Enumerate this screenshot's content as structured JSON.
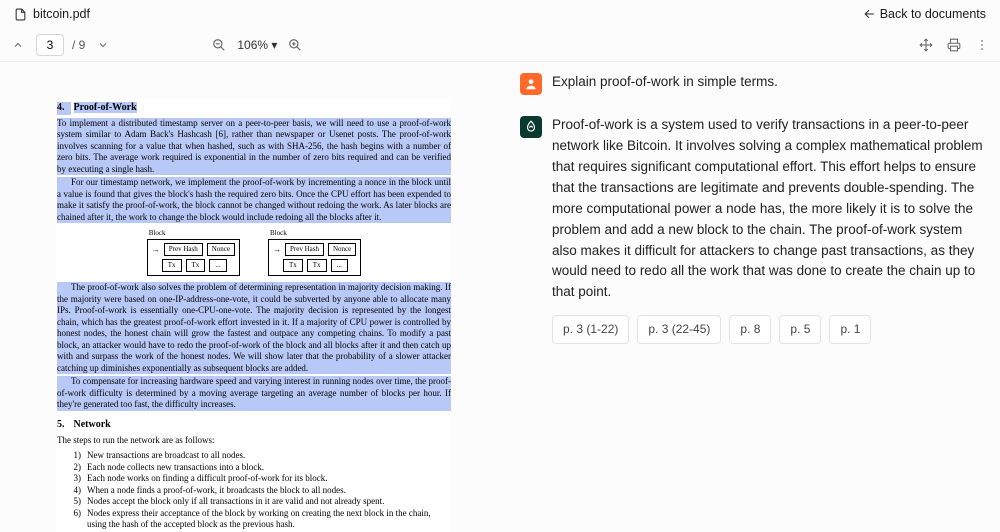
{
  "header": {
    "filename": "bitcoin.pdf",
    "back_label": "Back to documents"
  },
  "toolbar": {
    "page_current": "3",
    "page_total": "/ 9",
    "zoom_label": "106%"
  },
  "doc": {
    "sec4_num": "4.",
    "sec4_title": "Proof-of-Work",
    "p1a": "To implement a distributed timestamp server on a peer-to-peer basis, we will need to use a proof-of-work system similar to Adam Back's Hashcash [6], rather than newspaper or Usenet posts. The proof-of-work involves scanning for a value that when hashed, such as with SHA-256, the hash begins with a number of zero bits.  The average work required is exponential in the number of zero bits required and can be verified by executing a single hash.",
    "p1b": "For our timestamp network, we implement the proof-of-work by incrementing a nonce in the block until a value is found that gives the block's hash the required zero bits.  Once the CPU effort has been expended to make it satisfy the proof-of-work, the block cannot be changed without redoing the work.  As later blocks are chained after it, the work to change the block would include redoing all the blocks after it.",
    "diag": {
      "block_label": "Block",
      "prev": "Prev Hash",
      "nonce": "Nonce",
      "tx": "Tx",
      "dots": "..."
    },
    "p2a": "The proof-of-work also solves the problem of determining representation in majority decision making.  If the majority were based on one-IP-address-one-vote, it could be subverted by anyone able to allocate many IPs.  Proof-of-work is essentially one-CPU-one-vote.  The majority decision is represented by the longest chain, which has the greatest proof-of-work effort invested in it.  If a majority of CPU power is controlled by honest nodes, the honest chain will grow the fastest and outpace any competing chains.  To modify a past block, an attacker would have to redo the proof-of-work of the block and all blocks after it and then catch up with and surpass the work of the honest nodes.  We will show later that the probability of a slower attacker catching up diminishes exponentially as subsequent blocks are added.",
    "p2b": "To compensate for increasing hardware speed and varying interest in running nodes over time, the proof-of-work difficulty is determined by a moving average targeting an average number of blocks per hour.  If they're generated too fast, the difficulty increases.",
    "sec5_num": "5.",
    "sec5_title": "Network",
    "net_intro": "The steps to run the network are as follows:",
    "net_items": {
      "n1": "1)",
      "t1": "New transactions are broadcast to all nodes.",
      "n2": "2)",
      "t2": "Each node collects new transactions into a block.",
      "n3": "3)",
      "t3": "Each node works on finding a difficult proof-of-work for its block.",
      "n4": "4)",
      "t4": "When a node finds a proof-of-work, it broadcasts the block to all nodes.",
      "n5": "5)",
      "t5": "Nodes accept the block only if all transactions in it are valid and not already spent.",
      "n6": "6)",
      "t6": "Nodes express their acceptance of the block by working on creating the next block in the chain, using the hash of the accepted block as the previous hash."
    }
  },
  "chat": {
    "user_prompt": "Explain proof-of-work in simple terms.",
    "ai_answer": "Proof-of-work is a system used to verify transactions in a peer-to-peer network like Bitcoin. It involves solving a complex mathematical problem that requires significant computational effort. This effort helps to ensure that the transactions are legitimate and prevents double-spending. The more computational power a node has, the more likely it is to solve the problem and add a new block to the chain. The proof-of-work system also makes it difficult for attackers to change past transactions, as they would need to redo all the work that was done to create the chain up to that point.",
    "refs": {
      "r1": "p. 3 (1-22)",
      "r2": "p. 3 (22-45)",
      "r3": "p. 8",
      "r4": "p. 5",
      "r5": "p. 1"
    }
  }
}
